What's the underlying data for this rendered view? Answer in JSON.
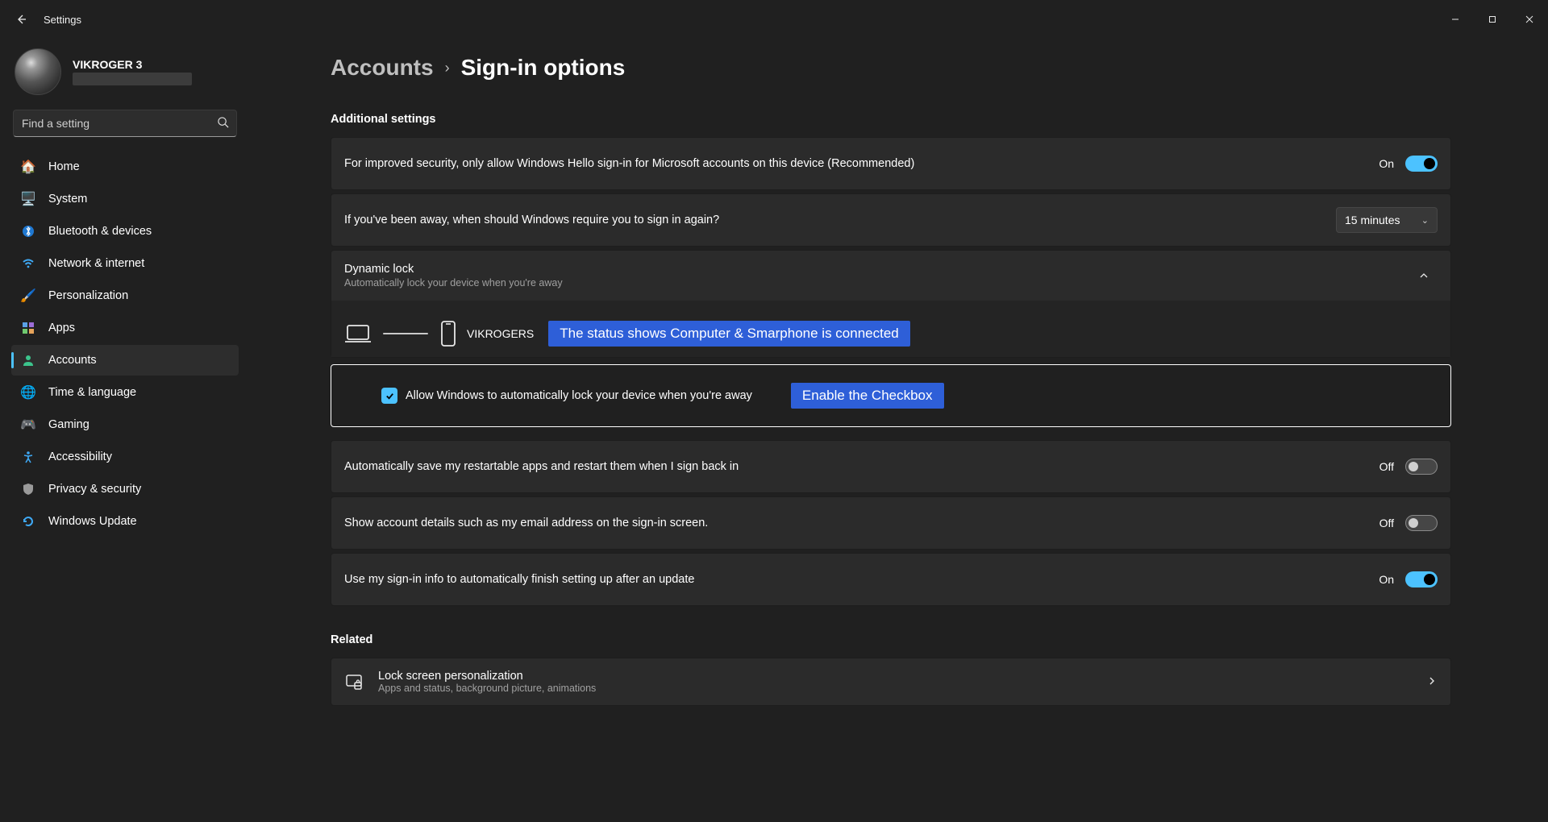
{
  "titlebar": {
    "app_name": "Settings"
  },
  "profile": {
    "name": "VIKROGER 3"
  },
  "search": {
    "placeholder": "Find a setting"
  },
  "nav": {
    "items": [
      {
        "label": "Home"
      },
      {
        "label": "System"
      },
      {
        "label": "Bluetooth & devices"
      },
      {
        "label": "Network & internet"
      },
      {
        "label": "Personalization"
      },
      {
        "label": "Apps"
      },
      {
        "label": "Accounts"
      },
      {
        "label": "Time & language"
      },
      {
        "label": "Gaming"
      },
      {
        "label": "Accessibility"
      },
      {
        "label": "Privacy & security"
      },
      {
        "label": "Windows Update"
      }
    ]
  },
  "breadcrumb": {
    "parent": "Accounts",
    "current": "Sign-in options"
  },
  "section_header": "Additional settings",
  "rows": {
    "hello_only": {
      "text": "For improved security, only allow Windows Hello sign-in for Microsoft accounts on this device (Recommended)",
      "state": "On"
    },
    "away_signin": {
      "text": "If you've been away, when should Windows require you to sign in again?",
      "value": "15 minutes"
    },
    "dynamic_lock": {
      "title": "Dynamic lock",
      "sub": "Automatically lock your device when you're away",
      "paired_name": "VIKROGERS",
      "checkbox_label": "Allow Windows to automatically lock your device when you're away"
    },
    "restartable": {
      "text": "Automatically save my restartable apps and restart them when I sign back in",
      "state": "Off"
    },
    "account_details": {
      "text": "Show account details such as my email address on the sign-in screen.",
      "state": "Off"
    },
    "after_update": {
      "text": "Use my sign-in info to automatically finish setting up after an update",
      "state": "On"
    }
  },
  "callouts": {
    "status": "The status shows Computer & Smarphone is connected",
    "checkbox": "Enable the Checkbox"
  },
  "related": {
    "header": "Related",
    "lock_screen": {
      "title": "Lock screen personalization",
      "sub": "Apps and status, background picture, animations"
    }
  }
}
